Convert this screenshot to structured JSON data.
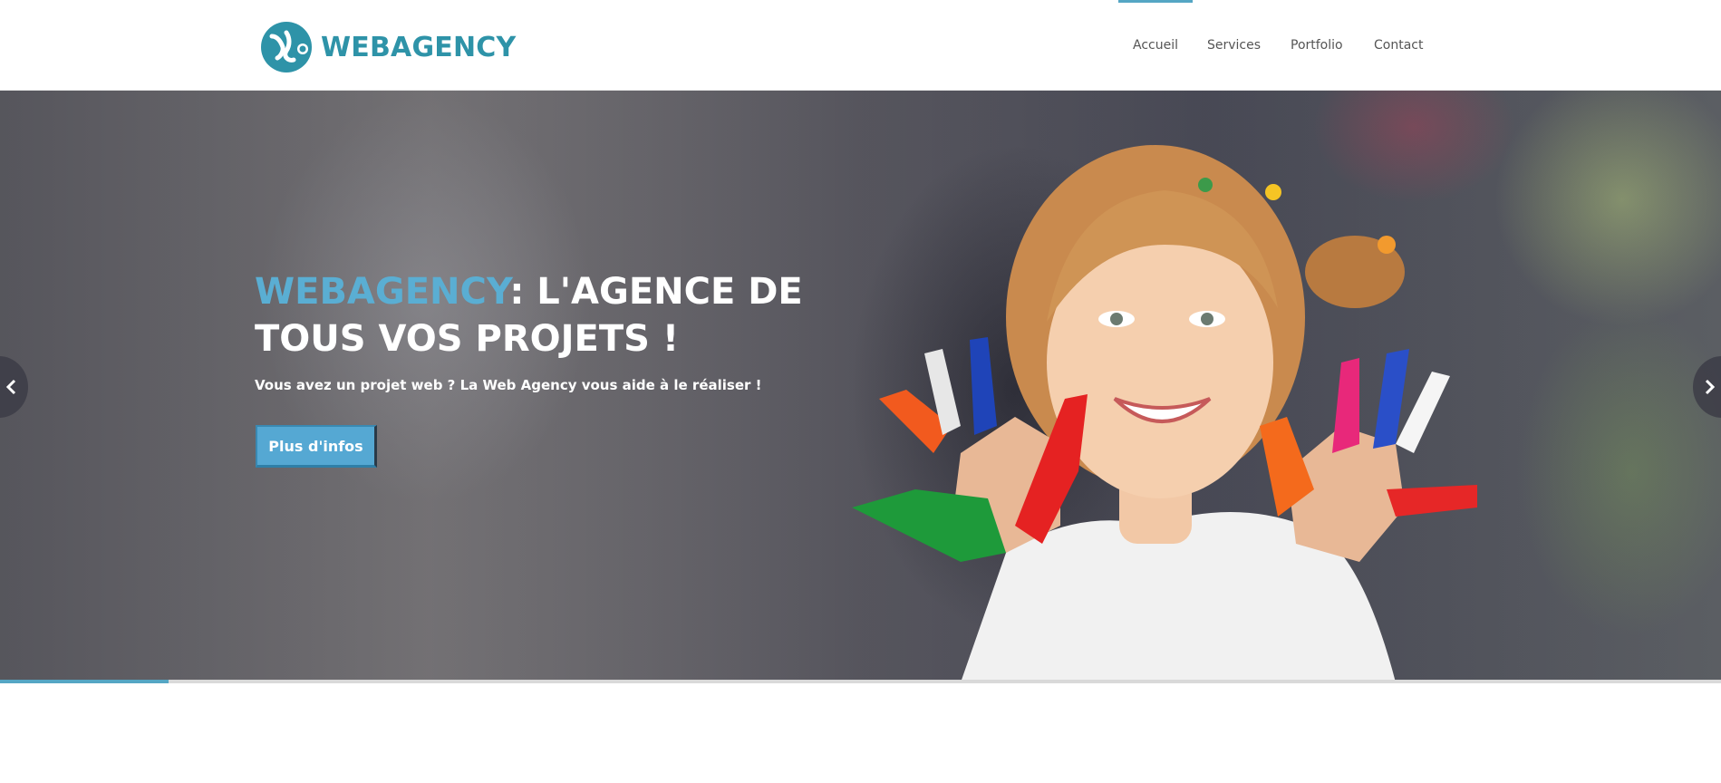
{
  "header": {
    "logo_text": "WEBAGENCY",
    "nav": [
      {
        "label": "Accueil",
        "active": true
      },
      {
        "label": "Services",
        "active": false
      },
      {
        "label": "Portfolio",
        "active": false
      },
      {
        "label": "Contact",
        "active": false
      }
    ]
  },
  "hero": {
    "title_brand": "WEBAGENCY",
    "title_rest": ": L'AGENCE DE TOUS VOS PROJETS !",
    "subtitle": "Vous avez un projet web ? La Web Agency vous aide à le réaliser !",
    "button_label": "Plus d'infos",
    "slide_progress": 0.098,
    "prev_icon": "chevron-left-icon",
    "next_icon": "chevron-right-icon"
  },
  "colors": {
    "accent": "#55a6c4",
    "logo": "#2e93a8",
    "button": "#55a8d3"
  }
}
